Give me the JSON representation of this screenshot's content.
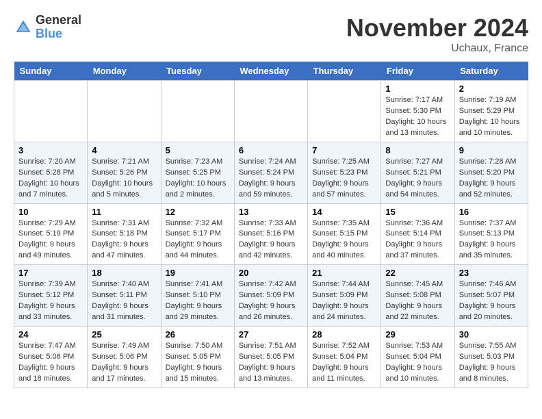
{
  "logo": {
    "general": "General",
    "blue": "Blue"
  },
  "title": "November 2024",
  "location": "Uchaux, France",
  "weekdays": [
    "Sunday",
    "Monday",
    "Tuesday",
    "Wednesday",
    "Thursday",
    "Friday",
    "Saturday"
  ],
  "weeks": [
    [
      {
        "day": "",
        "info": ""
      },
      {
        "day": "",
        "info": ""
      },
      {
        "day": "",
        "info": ""
      },
      {
        "day": "",
        "info": ""
      },
      {
        "day": "",
        "info": ""
      },
      {
        "day": "1",
        "info": "Sunrise: 7:17 AM\nSunset: 5:30 PM\nDaylight: 10 hours\nand 13 minutes."
      },
      {
        "day": "2",
        "info": "Sunrise: 7:19 AM\nSunset: 5:29 PM\nDaylight: 10 hours\nand 10 minutes."
      }
    ],
    [
      {
        "day": "3",
        "info": "Sunrise: 7:20 AM\nSunset: 5:28 PM\nDaylight: 10 hours\nand 7 minutes."
      },
      {
        "day": "4",
        "info": "Sunrise: 7:21 AM\nSunset: 5:26 PM\nDaylight: 10 hours\nand 5 minutes."
      },
      {
        "day": "5",
        "info": "Sunrise: 7:23 AM\nSunset: 5:25 PM\nDaylight: 10 hours\nand 2 minutes."
      },
      {
        "day": "6",
        "info": "Sunrise: 7:24 AM\nSunset: 5:24 PM\nDaylight: 9 hours\nand 59 minutes."
      },
      {
        "day": "7",
        "info": "Sunrise: 7:25 AM\nSunset: 5:23 PM\nDaylight: 9 hours\nand 57 minutes."
      },
      {
        "day": "8",
        "info": "Sunrise: 7:27 AM\nSunset: 5:21 PM\nDaylight: 9 hours\nand 54 minutes."
      },
      {
        "day": "9",
        "info": "Sunrise: 7:28 AM\nSunset: 5:20 PM\nDaylight: 9 hours\nand 52 minutes."
      }
    ],
    [
      {
        "day": "10",
        "info": "Sunrise: 7:29 AM\nSunset: 5:19 PM\nDaylight: 9 hours\nand 49 minutes."
      },
      {
        "day": "11",
        "info": "Sunrise: 7:31 AM\nSunset: 5:18 PM\nDaylight: 9 hours\nand 47 minutes."
      },
      {
        "day": "12",
        "info": "Sunrise: 7:32 AM\nSunset: 5:17 PM\nDaylight: 9 hours\nand 44 minutes."
      },
      {
        "day": "13",
        "info": "Sunrise: 7:33 AM\nSunset: 5:16 PM\nDaylight: 9 hours\nand 42 minutes."
      },
      {
        "day": "14",
        "info": "Sunrise: 7:35 AM\nSunset: 5:15 PM\nDaylight: 9 hours\nand 40 minutes."
      },
      {
        "day": "15",
        "info": "Sunrise: 7:36 AM\nSunset: 5:14 PM\nDaylight: 9 hours\nand 37 minutes."
      },
      {
        "day": "16",
        "info": "Sunrise: 7:37 AM\nSunset: 5:13 PM\nDaylight: 9 hours\nand 35 minutes."
      }
    ],
    [
      {
        "day": "17",
        "info": "Sunrise: 7:39 AM\nSunset: 5:12 PM\nDaylight: 9 hours\nand 33 minutes."
      },
      {
        "day": "18",
        "info": "Sunrise: 7:40 AM\nSunset: 5:11 PM\nDaylight: 9 hours\nand 31 minutes."
      },
      {
        "day": "19",
        "info": "Sunrise: 7:41 AM\nSunset: 5:10 PM\nDaylight: 9 hours\nand 29 minutes."
      },
      {
        "day": "20",
        "info": "Sunrise: 7:42 AM\nSunset: 5:09 PM\nDaylight: 9 hours\nand 26 minutes."
      },
      {
        "day": "21",
        "info": "Sunrise: 7:44 AM\nSunset: 5:09 PM\nDaylight: 9 hours\nand 24 minutes."
      },
      {
        "day": "22",
        "info": "Sunrise: 7:45 AM\nSunset: 5:08 PM\nDaylight: 9 hours\nand 22 minutes."
      },
      {
        "day": "23",
        "info": "Sunrise: 7:46 AM\nSunset: 5:07 PM\nDaylight: 9 hours\nand 20 minutes."
      }
    ],
    [
      {
        "day": "24",
        "info": "Sunrise: 7:47 AM\nSunset: 5:06 PM\nDaylight: 9 hours\nand 18 minutes."
      },
      {
        "day": "25",
        "info": "Sunrise: 7:49 AM\nSunset: 5:06 PM\nDaylight: 9 hours\nand 17 minutes."
      },
      {
        "day": "26",
        "info": "Sunrise: 7:50 AM\nSunset: 5:05 PM\nDaylight: 9 hours\nand 15 minutes."
      },
      {
        "day": "27",
        "info": "Sunrise: 7:51 AM\nSunset: 5:05 PM\nDaylight: 9 hours\nand 13 minutes."
      },
      {
        "day": "28",
        "info": "Sunrise: 7:52 AM\nSunset: 5:04 PM\nDaylight: 9 hours\nand 11 minutes."
      },
      {
        "day": "29",
        "info": "Sunrise: 7:53 AM\nSunset: 5:04 PM\nDaylight: 9 hours\nand 10 minutes."
      },
      {
        "day": "30",
        "info": "Sunrise: 7:55 AM\nSunset: 5:03 PM\nDaylight: 9 hours\nand 8 minutes."
      }
    ]
  ]
}
